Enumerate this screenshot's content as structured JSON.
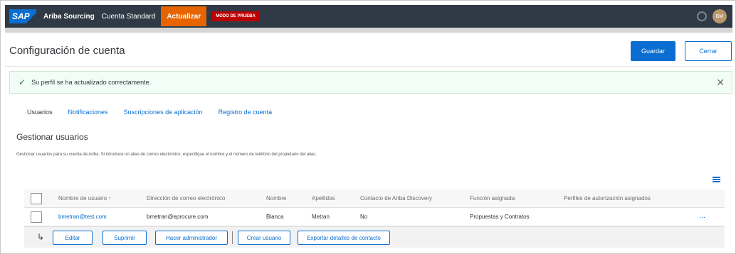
{
  "topbar": {
    "logo": "SAP",
    "product": "Ariba Sourcing",
    "account_type": "Cuenta Standard",
    "upgrade_label": "Actualizar",
    "test_mode_label": "MODO DE PRUEBA",
    "avatar_initials": "BM",
    "gear_icon": "gear-icon"
  },
  "header": {
    "title": "Configuración de cuenta",
    "save_label": "Guardar",
    "close_label": "Cerrar"
  },
  "message": {
    "text": "Su perfil se ha actualizado correctamente.",
    "icon": "check-icon",
    "dismiss_icon": "close-icon"
  },
  "tabs": [
    {
      "label": "Usuarios"
    },
    {
      "label": "Notificaciones"
    },
    {
      "label": "Suscripciones de aplicación"
    },
    {
      "label": "Registro de cuenta"
    }
  ],
  "section": {
    "title": "Gestionar usuarios",
    "description": "Gestionar usuarios para su cuenta de Ariba. Si introduce un alias de correo electrónico, especifique el nombre y el número de teléfono del propietario del alias."
  },
  "table": {
    "columns": [
      "Nombre de usuario ↑",
      "Dirección de correo electrónico",
      "Nombre",
      "Apellidos",
      "Contacto de Ariba Discovery",
      "Función asignada",
      "Perfiles de autorización asignados"
    ],
    "rows": [
      {
        "username": "bmetran@test.com",
        "email": "bmetran@eprocure.com",
        "first_name": "Blanca",
        "last_name": "Metran",
        "discovery": "No",
        "role": "Propuestas y Contratos",
        "profiles": ""
      }
    ]
  },
  "actions": {
    "edit": "Editar",
    "delete": "Suprimir",
    "make_admin": "Hacer administrador",
    "create_user": "Crear usuario",
    "export": "Exportar detalles de contacto"
  },
  "colors": {
    "topbar": "#2f3a46",
    "accent": "#0a6ed1",
    "upgrade": "#e76500",
    "test_badge": "#bb0000",
    "success_bg": "#f1fdf6"
  }
}
